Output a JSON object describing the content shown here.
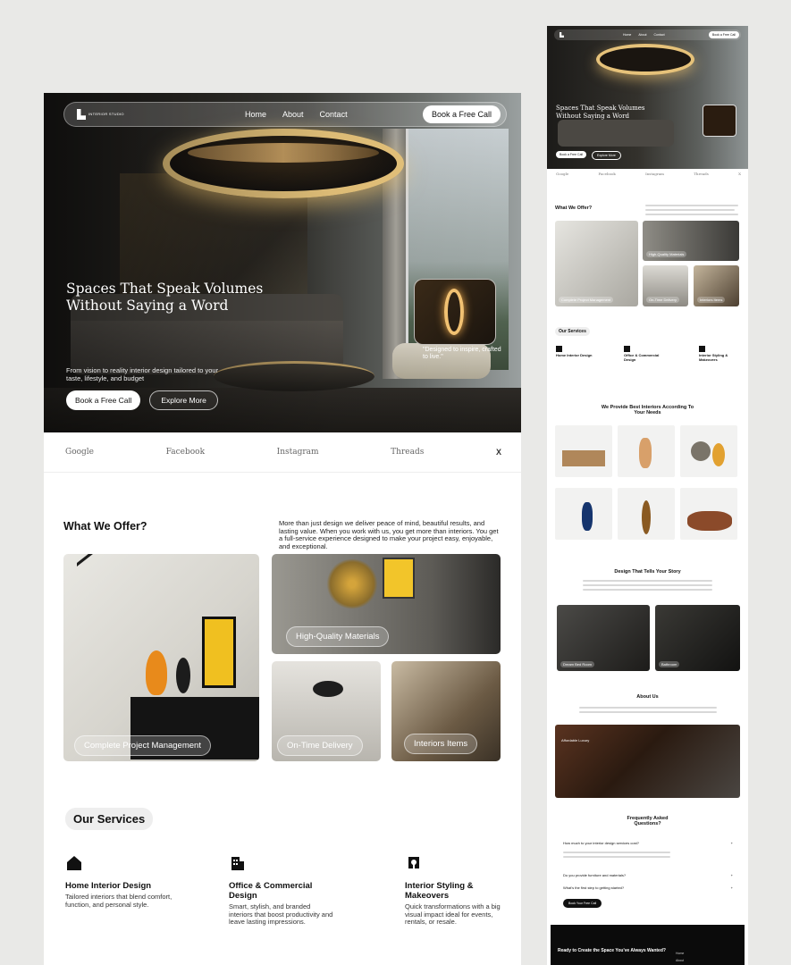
{
  "desktop": {
    "logo_text": "Interior Studio",
    "nav": {
      "links": [
        "Home",
        "About",
        "Contact"
      ],
      "cta": "Book a Free Call"
    },
    "hero": {
      "title": "Spaces That Speak Volumes Without Saying a Word",
      "subtitle": "From vision to reality interior design tailored to your taste, lifestyle, and budget",
      "primary_button": "Book a Free Call",
      "secondary_button": "Explore More",
      "card_quote": "\"Designed to inspire, crafted to live.\""
    },
    "brands": [
      "Google",
      "Facebook",
      "Instagram",
      "Threads",
      "X"
    ],
    "offer": {
      "title": "What We Offer?",
      "text": "More than just design  we deliver peace of mind, beautiful results, and lasting value. When you work with us, you get more than interiors. You get a full-service experience designed to make your project easy, enjoyable, and exceptional.",
      "tiles": [
        "Complete Project Management",
        "High-Quality Materials",
        "On-Time Delivery",
        "Interiors Items"
      ]
    },
    "services": {
      "pill": "Our Services",
      "items": [
        {
          "title": "Home Interior Design",
          "desc": "Tailored interiors that blend comfort, function, and personal style.",
          "icon": "house-icon"
        },
        {
          "title": "Office & Commercial Design",
          "desc": "Smart, stylish, and branded interiors that boost productivity and leave lasting impressions.",
          "icon": "building-icon"
        },
        {
          "title": "Interior Styling & Makeovers",
          "desc": "Quick transformations with a big visual impact ideal for events, rentals, or resale.",
          "icon": "lamp-icon"
        }
      ]
    }
  },
  "mobile": {
    "nav": {
      "links": [
        "Home",
        "About",
        "Contact"
      ],
      "cta": "Book a Free Call"
    },
    "hero": {
      "title": "Spaces That Speak Volumes Without Saying a Word",
      "primary_button": "Book a Free Call",
      "secondary_button": "Explore More"
    },
    "brands": [
      "Google",
      "Facebook",
      "Instagram",
      "Threads",
      "X"
    ],
    "offer_title": "What We Offer?",
    "tiles": [
      "High-Quality Materials",
      "Complete Project Management",
      "On-Time Delivery",
      "Interiors Items"
    ],
    "services_pill": "Our Services",
    "services": [
      "Home Interior Design",
      "Office & Commercial Design",
      "Interior Styling & Makeovers"
    ],
    "products_title": "We Provide Best Interiors According To Your Needs",
    "story_title": "Design That Tells Your Story",
    "story_images": [
      "Dream Bed Room",
      "Bathroom"
    ],
    "about_title": "About Us",
    "about_banner": "Affordable Luxury",
    "faq_title": "Frequently Asked Questions?",
    "faq": [
      "How much to your interior design services cost?",
      "Do you provide furniture and materials?",
      "What's the first step to getting started?"
    ],
    "faq_button": "Book Your Free Call",
    "cta_title": "Ready to Create the Space You've Always Wanted?",
    "footer_links": [
      "Home",
      "About"
    ]
  }
}
